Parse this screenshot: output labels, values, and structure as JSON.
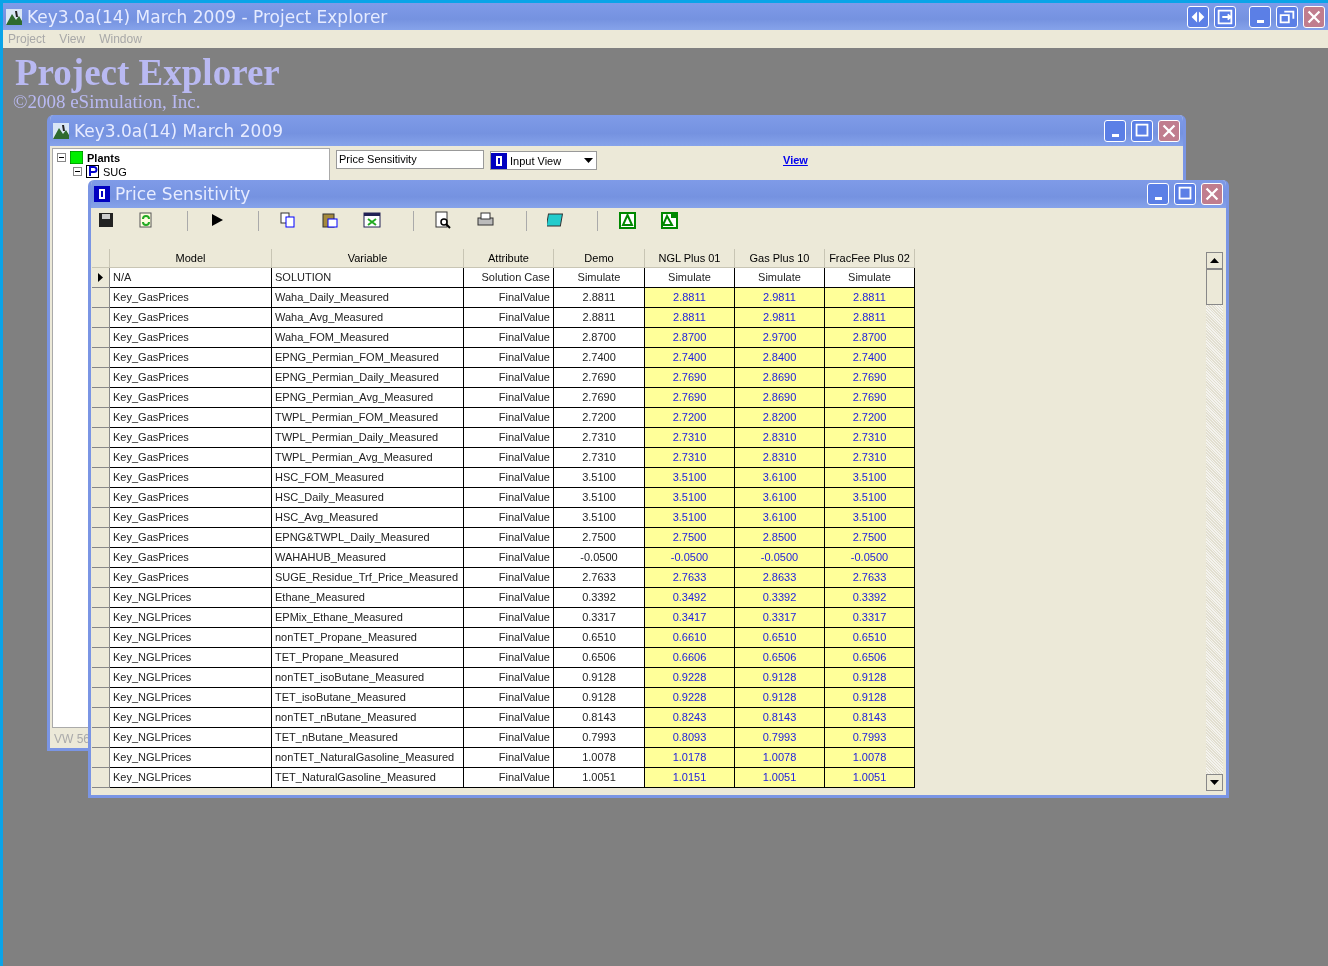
{
  "app_window": {
    "title": "Key3.0a(14) March 2009 - Project Explorer",
    "menu": [
      "Project",
      "View",
      "Window"
    ],
    "heading": "Project Explorer",
    "copyright": "©2008 eSimulation, Inc."
  },
  "project_window": {
    "title": "Key3.0a(14) March 2009",
    "tree": [
      {
        "label": "Plants",
        "expanded": true,
        "children": [
          {
            "label": "SUG",
            "expanded": true
          }
        ]
      }
    ],
    "name_field": "Price Sensitivity",
    "view_dropdown": "Input View",
    "view_link": "View",
    "status": "VW 56"
  },
  "sensitivity_window": {
    "title": "Price Sensitivity",
    "columns": [
      {
        "label": "Model",
        "highlighted": false
      },
      {
        "label": "Variable",
        "highlighted": false
      },
      {
        "label": "Attribute",
        "highlighted": false
      },
      {
        "label": "Demo",
        "highlighted": false
      },
      {
        "label": "NGL Plus 01",
        "highlighted": true
      },
      {
        "label": "Gas Plus 10",
        "highlighted": true
      },
      {
        "label": "FracFee Plus 02",
        "highlighted": true
      }
    ],
    "rows": [
      {
        "current": true,
        "cells": [
          "N/A",
          "SOLUTION",
          "Solution Case",
          "Simulate",
          "Simulate",
          "Simulate",
          "Simulate"
        ]
      },
      {
        "current": false,
        "cells": [
          "Key_GasPrices",
          "Waha_Daily_Measured",
          "FinalValue",
          "2.8811",
          "2.8811",
          "2.9811",
          "2.8811"
        ]
      },
      {
        "current": false,
        "cells": [
          "Key_GasPrices",
          "Waha_Avg_Measured",
          "FinalValue",
          "2.8811",
          "2.8811",
          "2.9811",
          "2.8811"
        ]
      },
      {
        "current": false,
        "cells": [
          "Key_GasPrices",
          "Waha_FOM_Measured",
          "FinalValue",
          "2.8700",
          "2.8700",
          "2.9700",
          "2.8700"
        ]
      },
      {
        "current": false,
        "cells": [
          "Key_GasPrices",
          "EPNG_Permian_FOM_Measured",
          "FinalValue",
          "2.7400",
          "2.7400",
          "2.8400",
          "2.7400"
        ]
      },
      {
        "current": false,
        "cells": [
          "Key_GasPrices",
          "EPNG_Permian_Daily_Measured",
          "FinalValue",
          "2.7690",
          "2.7690",
          "2.8690",
          "2.7690"
        ]
      },
      {
        "current": false,
        "cells": [
          "Key_GasPrices",
          "EPNG_Permian_Avg_Measured",
          "FinalValue",
          "2.7690",
          "2.7690",
          "2.8690",
          "2.7690"
        ]
      },
      {
        "current": false,
        "cells": [
          "Key_GasPrices",
          "TWPL_Permian_FOM_Measured",
          "FinalValue",
          "2.7200",
          "2.7200",
          "2.8200",
          "2.7200"
        ]
      },
      {
        "current": false,
        "cells": [
          "Key_GasPrices",
          "TWPL_Permian_Daily_Measured",
          "FinalValue",
          "2.7310",
          "2.7310",
          "2.8310",
          "2.7310"
        ]
      },
      {
        "current": false,
        "cells": [
          "Key_GasPrices",
          "TWPL_Permian_Avg_Measured",
          "FinalValue",
          "2.7310",
          "2.7310",
          "2.8310",
          "2.7310"
        ]
      },
      {
        "current": false,
        "cells": [
          "Key_GasPrices",
          "HSC_FOM_Measured",
          "FinalValue",
          "3.5100",
          "3.5100",
          "3.6100",
          "3.5100"
        ]
      },
      {
        "current": false,
        "cells": [
          "Key_GasPrices",
          "HSC_Daily_Measured",
          "FinalValue",
          "3.5100",
          "3.5100",
          "3.6100",
          "3.5100"
        ]
      },
      {
        "current": false,
        "cells": [
          "Key_GasPrices",
          "HSC_Avg_Measured",
          "FinalValue",
          "3.5100",
          "3.5100",
          "3.6100",
          "3.5100"
        ]
      },
      {
        "current": false,
        "cells": [
          "Key_GasPrices",
          "EPNG&TWPL_Daily_Measured",
          "FinalValue",
          "2.7500",
          "2.7500",
          "2.8500",
          "2.7500"
        ]
      },
      {
        "current": false,
        "cells": [
          "Key_GasPrices",
          "WAHAHUB_Measured",
          "FinalValue",
          "-0.0500",
          "-0.0500",
          "-0.0500",
          "-0.0500"
        ]
      },
      {
        "current": false,
        "cells": [
          "Key_GasPrices",
          "SUGE_Residue_Trf_Price_Measured",
          "FinalValue",
          "2.7633",
          "2.7633",
          "2.8633",
          "2.7633"
        ]
      },
      {
        "current": false,
        "cells": [
          "Key_NGLPrices",
          "Ethane_Measured",
          "FinalValue",
          "0.3392",
          "0.3492",
          "0.3392",
          "0.3392"
        ]
      },
      {
        "current": false,
        "cells": [
          "Key_NGLPrices",
          "EPMix_Ethane_Measured",
          "FinalValue",
          "0.3317",
          "0.3417",
          "0.3317",
          "0.3317"
        ]
      },
      {
        "current": false,
        "cells": [
          "Key_NGLPrices",
          "nonTET_Propane_Measured",
          "FinalValue",
          "0.6510",
          "0.6610",
          "0.6510",
          "0.6510"
        ]
      },
      {
        "current": false,
        "cells": [
          "Key_NGLPrices",
          "TET_Propane_Measured",
          "FinalValue",
          "0.6506",
          "0.6606",
          "0.6506",
          "0.6506"
        ]
      },
      {
        "current": false,
        "cells": [
          "Key_NGLPrices",
          "nonTET_isoButane_Measured",
          "FinalValue",
          "0.9128",
          "0.9228",
          "0.9128",
          "0.9128"
        ]
      },
      {
        "current": false,
        "cells": [
          "Key_NGLPrices",
          "TET_isoButane_Measured",
          "FinalValue",
          "0.9128",
          "0.9228",
          "0.9128",
          "0.9128"
        ]
      },
      {
        "current": false,
        "cells": [
          "Key_NGLPrices",
          "nonTET_nButane_Measured",
          "FinalValue",
          "0.8143",
          "0.8243",
          "0.8143",
          "0.8143"
        ]
      },
      {
        "current": false,
        "cells": [
          "Key_NGLPrices",
          "TET_nButane_Measured",
          "FinalValue",
          "0.7993",
          "0.8093",
          "0.7993",
          "0.7993"
        ]
      },
      {
        "current": false,
        "cells": [
          "Key_NGLPrices",
          "nonTET_NaturalGasoline_Measured",
          "FinalValue",
          "1.0078",
          "1.0178",
          "1.0078",
          "1.0078"
        ]
      },
      {
        "current": false,
        "cells": [
          "Key_NGLPrices",
          "TET_NaturalGasoline_Measured",
          "FinalValue",
          "1.0051",
          "1.0151",
          "1.0051",
          "1.0051"
        ]
      }
    ]
  }
}
